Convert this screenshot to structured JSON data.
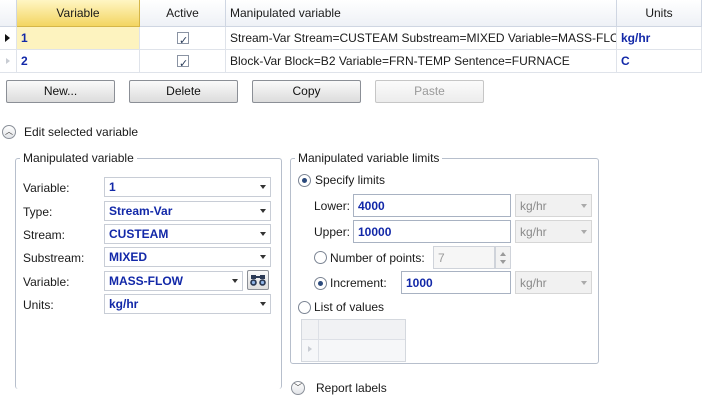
{
  "grid": {
    "headers": {
      "variable": "Variable",
      "active": "Active",
      "manipulated": "Manipulated variable",
      "units": "Units"
    },
    "rows": [
      {
        "num": "1",
        "active": true,
        "desc": "Stream-Var Stream=CUSTEAM Substream=MIXED Variable=MASS-FLOW",
        "units": "kg/hr"
      },
      {
        "num": "2",
        "active": true,
        "desc": "Block-Var Block=B2 Variable=FRN-TEMP Sentence=FURNACE",
        "units": "C"
      }
    ]
  },
  "buttons": {
    "new": "New...",
    "delete": "Delete",
    "copy": "Copy",
    "paste": "Paste"
  },
  "edit_section": {
    "title": "Edit selected variable"
  },
  "manip": {
    "title": "Manipulated variable",
    "fields": {
      "variable": {
        "label": "Variable:",
        "value": "1"
      },
      "type": {
        "label": "Type:",
        "value": "Stream-Var"
      },
      "stream": {
        "label": "Stream:",
        "value": "CUSTEAM"
      },
      "substream": {
        "label": "Substream:",
        "value": "MIXED"
      },
      "var2": {
        "label": "Variable:",
        "value": "MASS-FLOW"
      },
      "units": {
        "label": "Units:",
        "value": "kg/hr"
      }
    }
  },
  "limits": {
    "title": "Manipulated variable limits",
    "specify": "Specify limits",
    "lower": {
      "label": "Lower:",
      "value": "4000",
      "unit": "kg/hr"
    },
    "upper": {
      "label": "Upper:",
      "value": "10000",
      "unit": "kg/hr"
    },
    "npoints": {
      "label": "Number of points:",
      "value": "7"
    },
    "increment": {
      "label": "Increment:",
      "value": "1000",
      "unit": "kg/hr"
    },
    "list": "List of values"
  },
  "report": {
    "title": "Report labels"
  }
}
